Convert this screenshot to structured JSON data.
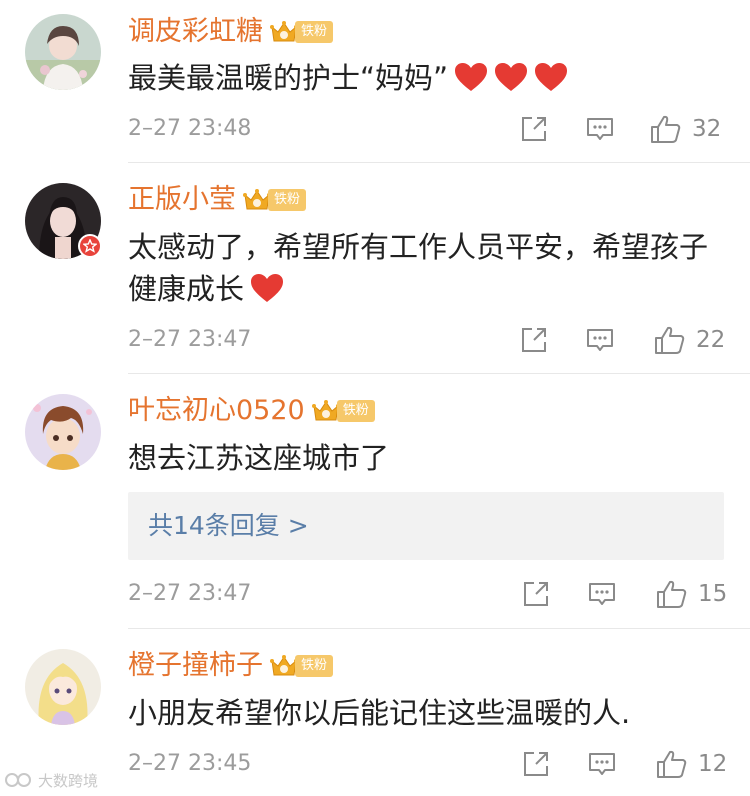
{
  "colors": {
    "username": "#e5742f",
    "time": "#9c9c9c",
    "heart": "#e53a33",
    "fan_badge": "#f6c86a",
    "reply_link": "#5a7ea8",
    "reply_bg": "#f2f2f2"
  },
  "badge_label": "铁粉",
  "comments": [
    {
      "username": "调皮彩虹糖",
      "badge": "铁粉",
      "text": "最美最温暖的护士“妈妈”",
      "hearts": 3,
      "time": "2–27 23:48",
      "likes": "32"
    },
    {
      "username": "正版小莹",
      "badge": "铁粉",
      "text": "太感动了，希望所有工作人员平安，希望孩子健康成长",
      "hearts": 1,
      "time": "2–27 23:47",
      "likes": "22"
    },
    {
      "username": "叶忘初心0520",
      "badge": "铁粉",
      "text": "想去江苏这座城市了",
      "hearts": 0,
      "replies_label": "共14条回复 >",
      "time": "2–27 23:47",
      "likes": "15"
    },
    {
      "username": "橙子撞柿子",
      "badge": "铁粉",
      "text": "小朋友希望你以后能记住这些温暖的人.",
      "hearts": 0,
      "time": "2–27 23:45",
      "likes": "12"
    }
  ],
  "watermark": "大数跨境"
}
